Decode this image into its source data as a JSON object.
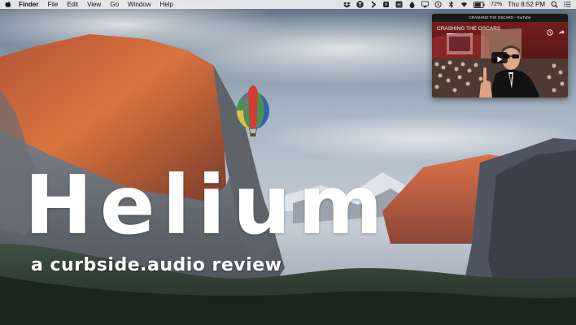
{
  "menubar": {
    "app_name": "Finder",
    "items": [
      "File",
      "Edit",
      "View",
      "Go",
      "Window",
      "Help"
    ],
    "battery_percent": "72%",
    "clock": "Thu 8:52 PM",
    "status_icons": [
      "dropbox-icon",
      "text-expander-icon",
      "chevron-icon",
      "evernote-icon",
      "helium-icon",
      "airplay-icon",
      "time-machine-icon",
      "drop-icon",
      "bluetooth-icon",
      "wifi-icon",
      "battery-icon",
      "volume-icon",
      "spotlight-icon",
      "notification-center-icon"
    ]
  },
  "video_window": {
    "window_title": "CRASHING THE OSCARS - YouTube",
    "headline": "CRASHING THE OSCARS",
    "controls": [
      "clock-icon",
      "share-icon",
      "play-icon"
    ]
  },
  "overlay": {
    "title": "Helium",
    "subtitle": "a curbside.audio review"
  },
  "colors": {
    "menubar": "#eeeef0",
    "title_text": "#ffffff",
    "sky": "#a9b8c7",
    "cliff_glow": "#c4633a",
    "valley": "#2f4030"
  }
}
